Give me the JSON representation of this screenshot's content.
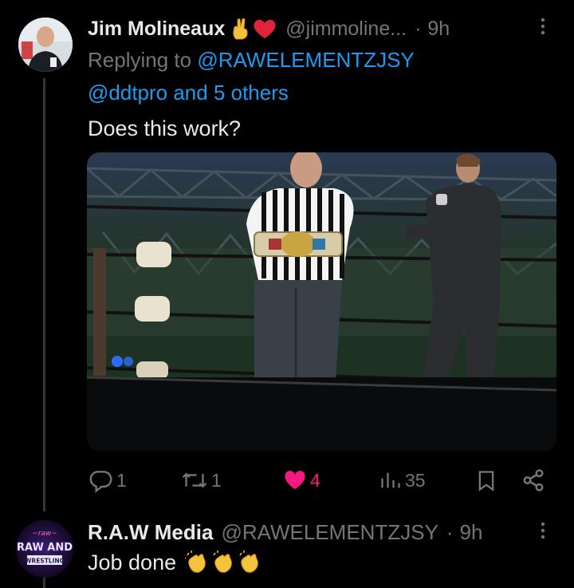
{
  "tweet1": {
    "author_name": "Jim Molineaux",
    "author_emojis": "✌❤",
    "handle": "@jimmoline...",
    "dot": "·",
    "time": "9h",
    "more_label": "⋮",
    "replying_prefix": "Replying to",
    "mention_primary": "@RAWELEMENTZJSY",
    "mention_secondary": "@ddtpro and 5 others",
    "text": "Does this work?",
    "actions": {
      "reply_count": "1",
      "retweet_count": "1",
      "like_count": "4",
      "views_count": "35",
      "liked": true,
      "like_color": "#f91880"
    }
  },
  "tweet2": {
    "author_name": "R.A.W Media",
    "handle": "@RAWELEMENTZJSY",
    "dot": "·",
    "time": "9h",
    "more_label": "⋮",
    "text": "Job done",
    "emojis": "👏👏👏",
    "avatar_logo": {
      "line1": "RAW AND",
      "line2": "WRESTLING"
    }
  },
  "icons": [
    "reply-icon",
    "retweet-icon",
    "heart-icon",
    "views-icon",
    "bookmark-icon",
    "share-icon"
  ],
  "colors": {
    "background": "#000000",
    "text": "#e7e9ea",
    "muted": "#71767b",
    "link": "#1d9bf0",
    "like": "#f91880"
  }
}
